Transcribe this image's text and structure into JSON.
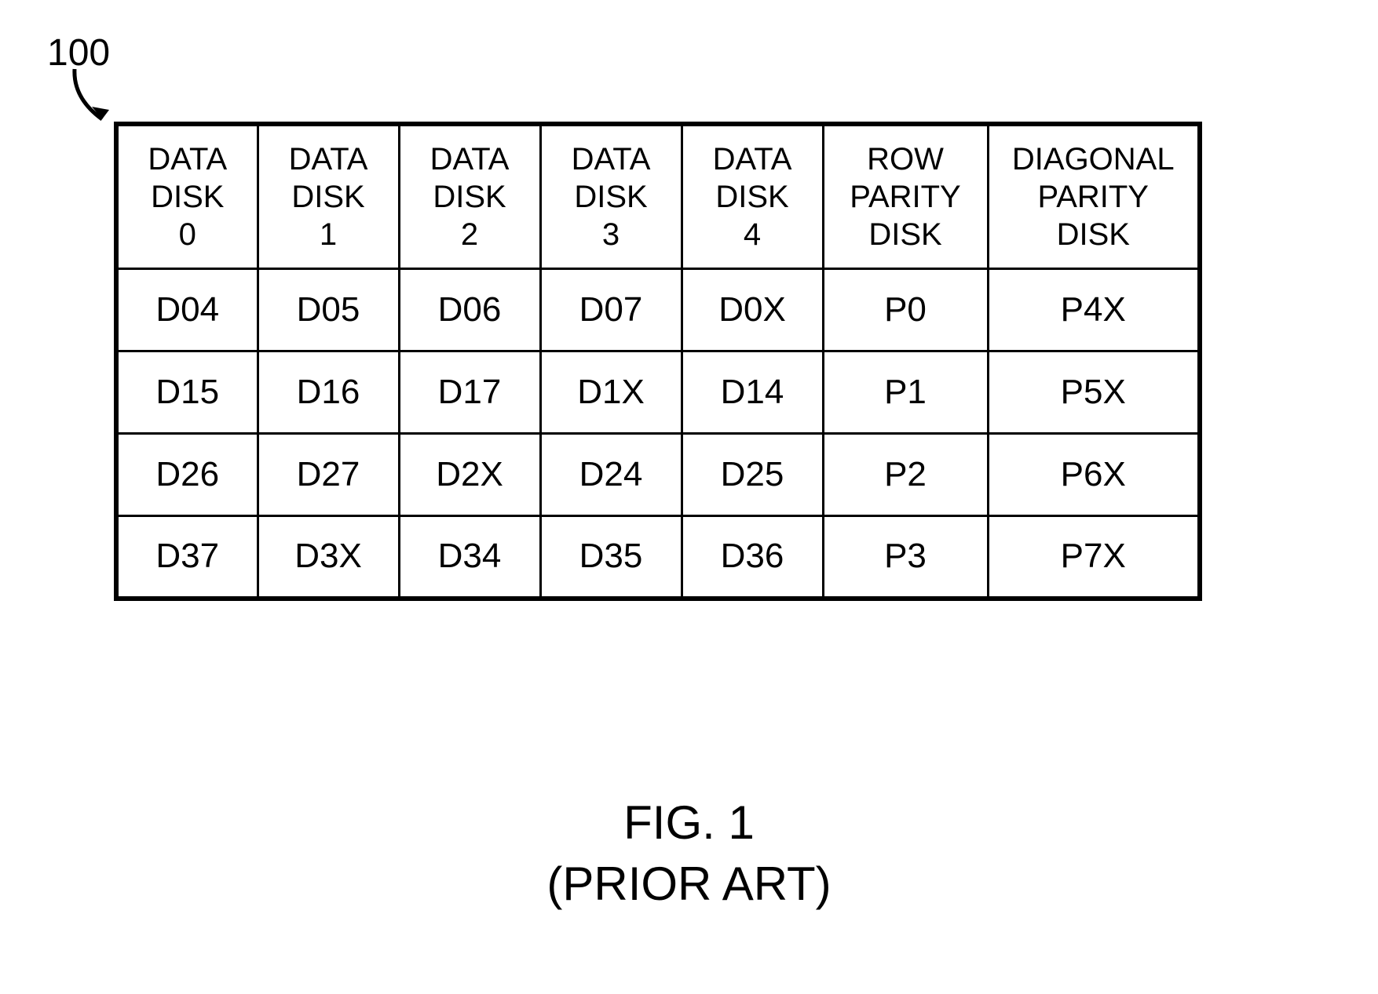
{
  "reference_number": "100",
  "chart_data": {
    "type": "table",
    "headers": [
      "DATA\nDISK\n0",
      "DATA\nDISK\n1",
      "DATA\nDISK\n2",
      "DATA\nDISK\n3",
      "DATA\nDISK\n4",
      "ROW\nPARITY\nDISK",
      "DIAGONAL\nPARITY\nDISK"
    ],
    "rows": [
      [
        "D04",
        "D05",
        "D06",
        "D07",
        "D0X",
        "P0",
        "P4X"
      ],
      [
        "D15",
        "D16",
        "D17",
        "D1X",
        "D14",
        "P1",
        "P5X"
      ],
      [
        "D26",
        "D27",
        "D2X",
        "D24",
        "D25",
        "P2",
        "P6X"
      ],
      [
        "D37",
        "D3X",
        "D34",
        "D35",
        "D36",
        "P3",
        "P7X"
      ]
    ]
  },
  "caption_line1": "FIG. 1",
  "caption_line2": "(PRIOR ART)"
}
